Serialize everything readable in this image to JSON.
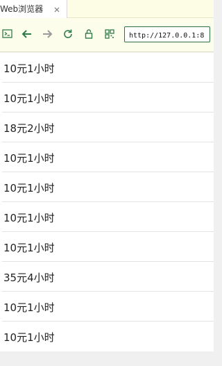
{
  "browser": {
    "tab": {
      "title": "Web浏览器",
      "close_icon": "close-icon"
    },
    "toolbar": {
      "icons": [
        "console-icon",
        "back-arrow-icon",
        "forward-arrow-icon",
        "refresh-icon",
        "lock-icon",
        "qr-code-icon"
      ],
      "url": "http://127.0.0.1:8"
    },
    "accent_color": "#2f6e43"
  },
  "list": {
    "items": [
      {
        "label": "10元1小时"
      },
      {
        "label": "10元1小时"
      },
      {
        "label": "18元2小时"
      },
      {
        "label": "10元1小时"
      },
      {
        "label": "10元1小时"
      },
      {
        "label": "10元1小时"
      },
      {
        "label": "10元1小时"
      },
      {
        "label": "35元4小时"
      },
      {
        "label": "10元1小时"
      },
      {
        "label": "10元1小时"
      }
    ]
  }
}
